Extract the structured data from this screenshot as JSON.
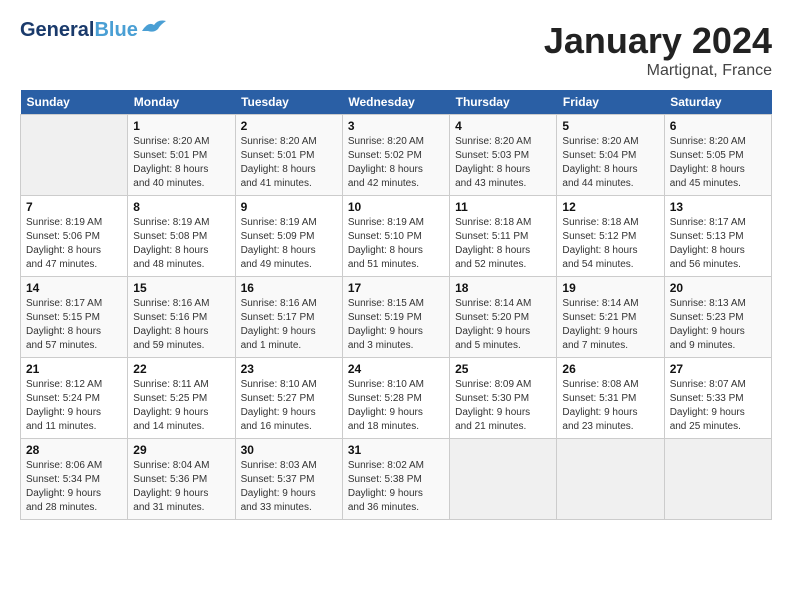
{
  "header": {
    "logo_line1": "General",
    "logo_line2": "Blue",
    "month_title": "January 2024",
    "location": "Martignat, France"
  },
  "days_of_week": [
    "Sunday",
    "Monday",
    "Tuesday",
    "Wednesday",
    "Thursday",
    "Friday",
    "Saturday"
  ],
  "weeks": [
    [
      {
        "day": "",
        "info": ""
      },
      {
        "day": "1",
        "info": "Sunrise: 8:20 AM\nSunset: 5:01 PM\nDaylight: 8 hours\nand 40 minutes."
      },
      {
        "day": "2",
        "info": "Sunrise: 8:20 AM\nSunset: 5:01 PM\nDaylight: 8 hours\nand 41 minutes."
      },
      {
        "day": "3",
        "info": "Sunrise: 8:20 AM\nSunset: 5:02 PM\nDaylight: 8 hours\nand 42 minutes."
      },
      {
        "day": "4",
        "info": "Sunrise: 8:20 AM\nSunset: 5:03 PM\nDaylight: 8 hours\nand 43 minutes."
      },
      {
        "day": "5",
        "info": "Sunrise: 8:20 AM\nSunset: 5:04 PM\nDaylight: 8 hours\nand 44 minutes."
      },
      {
        "day": "6",
        "info": "Sunrise: 8:20 AM\nSunset: 5:05 PM\nDaylight: 8 hours\nand 45 minutes."
      }
    ],
    [
      {
        "day": "7",
        "info": "Sunrise: 8:19 AM\nSunset: 5:06 PM\nDaylight: 8 hours\nand 47 minutes."
      },
      {
        "day": "8",
        "info": "Sunrise: 8:19 AM\nSunset: 5:08 PM\nDaylight: 8 hours\nand 48 minutes."
      },
      {
        "day": "9",
        "info": "Sunrise: 8:19 AM\nSunset: 5:09 PM\nDaylight: 8 hours\nand 49 minutes."
      },
      {
        "day": "10",
        "info": "Sunrise: 8:19 AM\nSunset: 5:10 PM\nDaylight: 8 hours\nand 51 minutes."
      },
      {
        "day": "11",
        "info": "Sunrise: 8:18 AM\nSunset: 5:11 PM\nDaylight: 8 hours\nand 52 minutes."
      },
      {
        "day": "12",
        "info": "Sunrise: 8:18 AM\nSunset: 5:12 PM\nDaylight: 8 hours\nand 54 minutes."
      },
      {
        "day": "13",
        "info": "Sunrise: 8:17 AM\nSunset: 5:13 PM\nDaylight: 8 hours\nand 56 minutes."
      }
    ],
    [
      {
        "day": "14",
        "info": "Sunrise: 8:17 AM\nSunset: 5:15 PM\nDaylight: 8 hours\nand 57 minutes."
      },
      {
        "day": "15",
        "info": "Sunrise: 8:16 AM\nSunset: 5:16 PM\nDaylight: 8 hours\nand 59 minutes."
      },
      {
        "day": "16",
        "info": "Sunrise: 8:16 AM\nSunset: 5:17 PM\nDaylight: 9 hours\nand 1 minute."
      },
      {
        "day": "17",
        "info": "Sunrise: 8:15 AM\nSunset: 5:19 PM\nDaylight: 9 hours\nand 3 minutes."
      },
      {
        "day": "18",
        "info": "Sunrise: 8:14 AM\nSunset: 5:20 PM\nDaylight: 9 hours\nand 5 minutes."
      },
      {
        "day": "19",
        "info": "Sunrise: 8:14 AM\nSunset: 5:21 PM\nDaylight: 9 hours\nand 7 minutes."
      },
      {
        "day": "20",
        "info": "Sunrise: 8:13 AM\nSunset: 5:23 PM\nDaylight: 9 hours\nand 9 minutes."
      }
    ],
    [
      {
        "day": "21",
        "info": "Sunrise: 8:12 AM\nSunset: 5:24 PM\nDaylight: 9 hours\nand 11 minutes."
      },
      {
        "day": "22",
        "info": "Sunrise: 8:11 AM\nSunset: 5:25 PM\nDaylight: 9 hours\nand 14 minutes."
      },
      {
        "day": "23",
        "info": "Sunrise: 8:10 AM\nSunset: 5:27 PM\nDaylight: 9 hours\nand 16 minutes."
      },
      {
        "day": "24",
        "info": "Sunrise: 8:10 AM\nSunset: 5:28 PM\nDaylight: 9 hours\nand 18 minutes."
      },
      {
        "day": "25",
        "info": "Sunrise: 8:09 AM\nSunset: 5:30 PM\nDaylight: 9 hours\nand 21 minutes."
      },
      {
        "day": "26",
        "info": "Sunrise: 8:08 AM\nSunset: 5:31 PM\nDaylight: 9 hours\nand 23 minutes."
      },
      {
        "day": "27",
        "info": "Sunrise: 8:07 AM\nSunset: 5:33 PM\nDaylight: 9 hours\nand 25 minutes."
      }
    ],
    [
      {
        "day": "28",
        "info": "Sunrise: 8:06 AM\nSunset: 5:34 PM\nDaylight: 9 hours\nand 28 minutes."
      },
      {
        "day": "29",
        "info": "Sunrise: 8:04 AM\nSunset: 5:36 PM\nDaylight: 9 hours\nand 31 minutes."
      },
      {
        "day": "30",
        "info": "Sunrise: 8:03 AM\nSunset: 5:37 PM\nDaylight: 9 hours\nand 33 minutes."
      },
      {
        "day": "31",
        "info": "Sunrise: 8:02 AM\nSunset: 5:38 PM\nDaylight: 9 hours\nand 36 minutes."
      },
      {
        "day": "",
        "info": ""
      },
      {
        "day": "",
        "info": ""
      },
      {
        "day": "",
        "info": ""
      }
    ]
  ]
}
